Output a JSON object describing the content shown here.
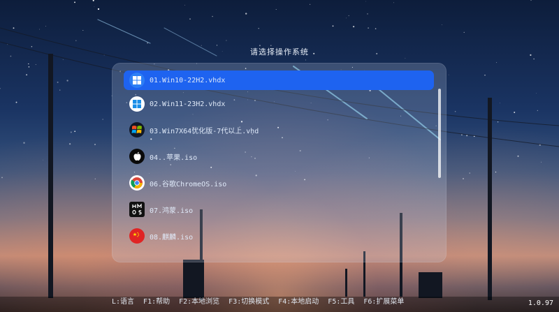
{
  "header": {
    "title": "请选择操作系统"
  },
  "menu": {
    "items": [
      {
        "label": "01.Win10-22H2.vhdx",
        "icon": "windows10-icon",
        "selected": true
      },
      {
        "label": "02.Win11-23H2.vhdx",
        "icon": "windows11-icon",
        "selected": false
      },
      {
        "label": "03.Win7X64优化版-7代以上.vhd",
        "icon": "windows7-icon",
        "selected": false
      },
      {
        "label": "04..苹果.iso",
        "icon": "apple-icon",
        "selected": false
      },
      {
        "label": "06.谷歌ChromeOS.iso",
        "icon": "chrome-icon",
        "selected": false
      },
      {
        "label": "07.鸿蒙.iso",
        "icon": "harmonyos-icon",
        "selected": false
      },
      {
        "label": "08.麒麟.iso",
        "icon": "china-flag-icon",
        "selected": false
      }
    ]
  },
  "footer": {
    "keys": [
      "L:语言",
      "F1:帮助",
      "F2:本地浏览",
      "F3:切换模式",
      "F4:本地启动",
      "F5:工具",
      "F6:扩展菜单"
    ],
    "version": "1.0.97"
  },
  "colors": {
    "selected": "#1e63f0",
    "panel": "rgba(200,215,235,0.22)"
  }
}
